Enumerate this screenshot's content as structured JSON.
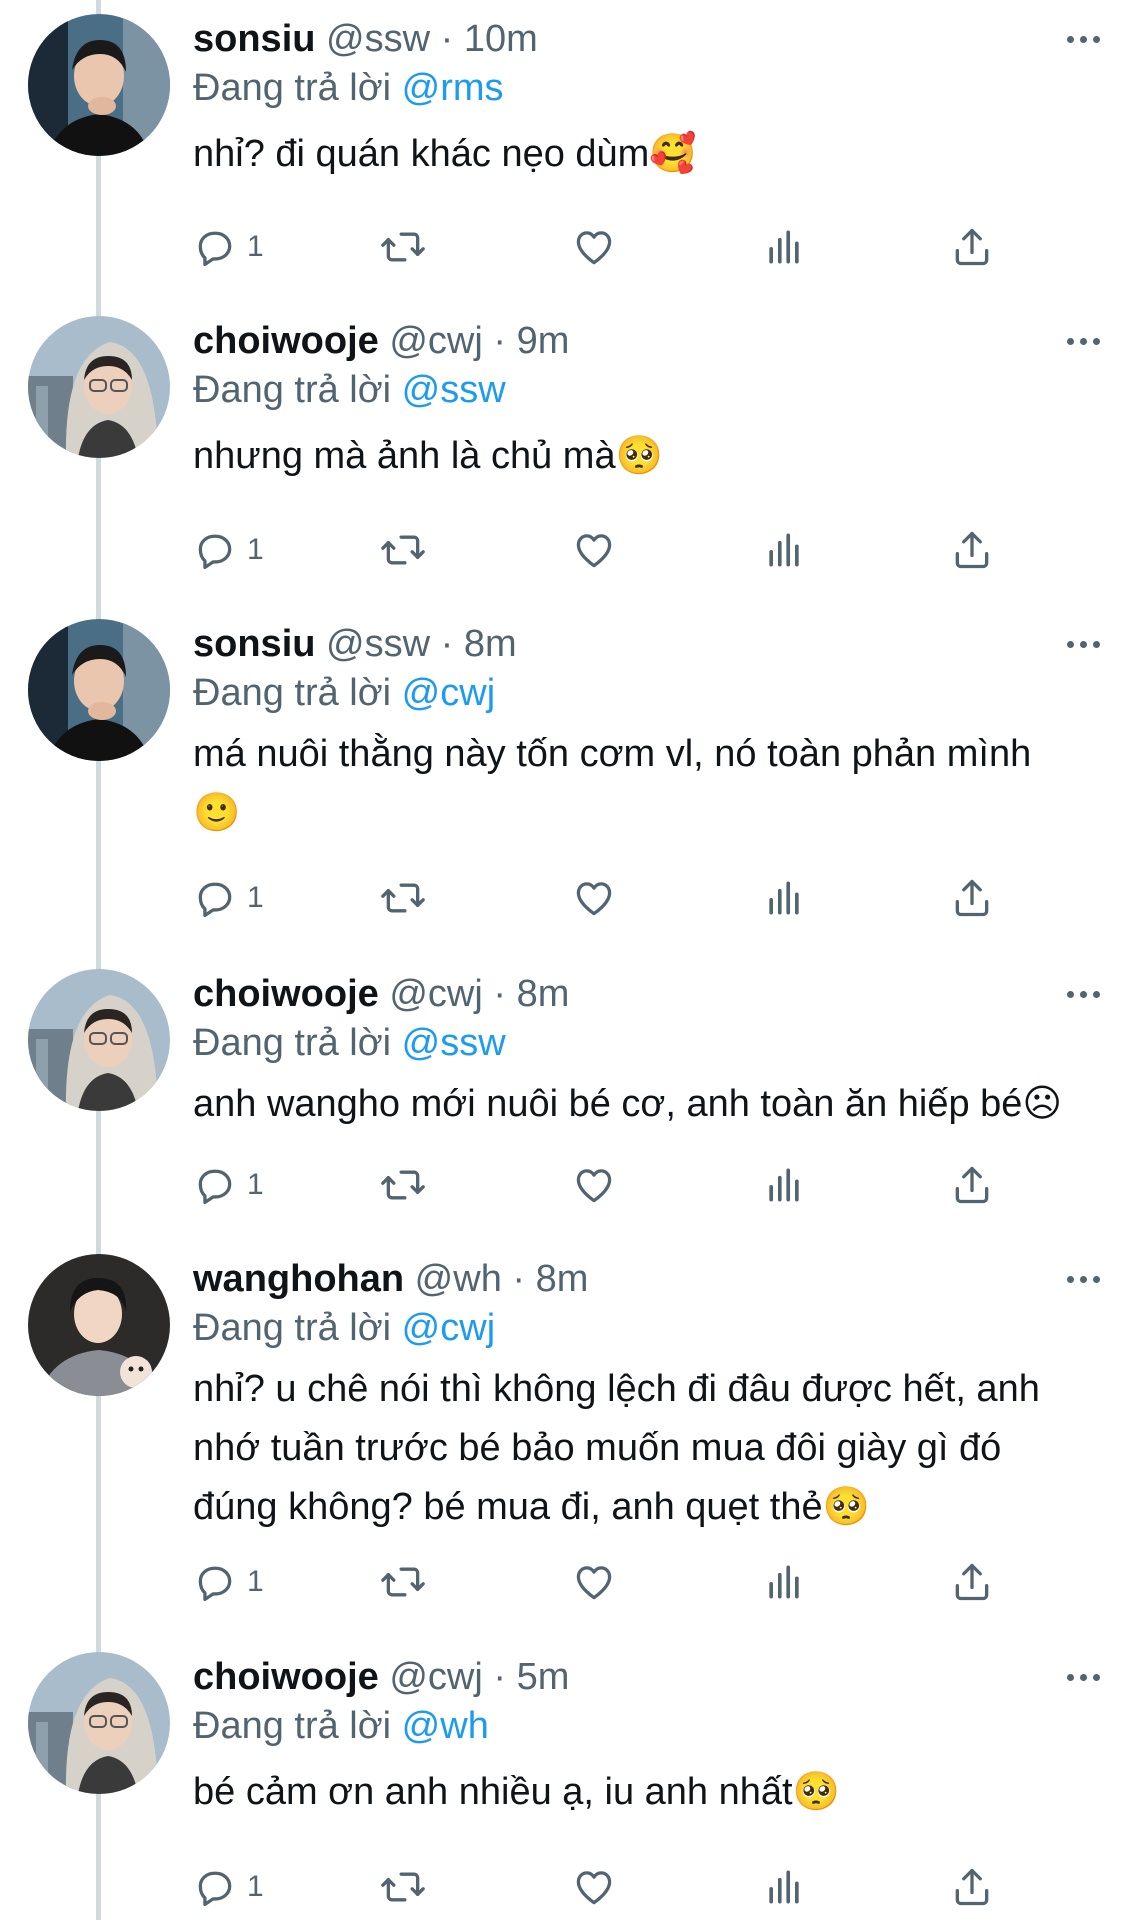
{
  "tweets": [
    {
      "name": "sonsiu",
      "handle": "@ssw",
      "time": "10m",
      "replying_prefix": "Đang trả lời",
      "replying_to": "@rms",
      "text": "nhỉ? đi quán khác nẹo dùm🥰",
      "reply_count": "1",
      "avatar": "sonsiu-avatar"
    },
    {
      "name": "choiwooje",
      "handle": "@cwj",
      "time": "9m",
      "replying_prefix": "Đang trả lời",
      "replying_to": "@ssw",
      "text": "nhưng mà ảnh là chủ mà🥺",
      "reply_count": "1",
      "avatar": "choiwooje-avatar"
    },
    {
      "name": "sonsiu",
      "handle": "@ssw",
      "time": "8m",
      "replying_prefix": "Đang trả lời",
      "replying_to": "@cwj",
      "text": "má nuôi thằng này tốn cơm vl, nó toàn phản mình\n🙂",
      "reply_count": "1",
      "avatar": "sonsiu-avatar"
    },
    {
      "name": "choiwooje",
      "handle": "@cwj",
      "time": "8m",
      "replying_prefix": "Đang trả lời",
      "replying_to": "@ssw",
      "text": "anh wangho mới nuôi bé cơ, anh toàn ăn hiếp bé☹",
      "reply_count": "1",
      "avatar": "choiwooje-avatar"
    },
    {
      "name": "wanghohan",
      "handle": "@wh",
      "time": "8m",
      "replying_prefix": "Đang trả lời",
      "replying_to": "@cwj",
      "text": "nhỉ? u chê nói thì không lệch đi đâu được hết, anh\nnhớ tuần trước bé bảo muốn mua đôi giày gì đó\nđúng không? bé mua đi, anh quẹt thẻ🥺",
      "reply_count": "1",
      "avatar": "wanghohan-avatar"
    },
    {
      "name": "choiwooje",
      "handle": "@cwj",
      "time": "5m",
      "replying_prefix": "Đang trả lời",
      "replying_to": "@wh",
      "text": "bé cảm ơn anh nhiều ạ, iu anh nhất🥺",
      "reply_count": "1",
      "avatar": "choiwooje-avatar"
    }
  ],
  "separator": "·",
  "colors": {
    "text": "#0f1419",
    "secondary": "#536471",
    "mention": "#1d9bf0",
    "thread_line": "#cfd9de"
  },
  "icons": [
    "reply-icon",
    "retweet-icon",
    "like-icon",
    "views-icon",
    "share-icon",
    "more-icon"
  ]
}
